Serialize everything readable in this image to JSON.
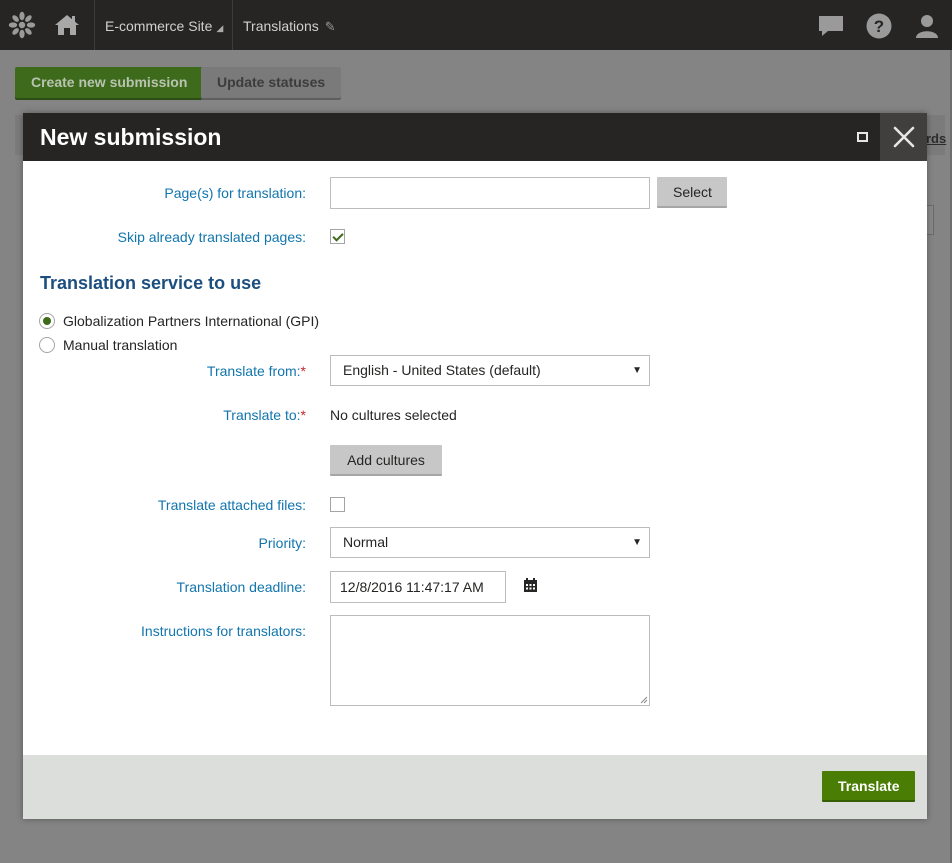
{
  "topbar": {
    "site_name": "E-commerce Site",
    "app_name": "Translations"
  },
  "background": {
    "create_button": "Create new submission",
    "update_button": "Update statuses",
    "partial_link": "rds"
  },
  "dialog": {
    "title": "New submission",
    "fields": {
      "pages_label": "Page(s) for translation:",
      "pages_value": "",
      "select_button": "Select",
      "skip_label": "Skip already translated pages:",
      "skip_checked": true
    },
    "service_section": {
      "title": "Translation service to use",
      "options": [
        {
          "label": "Globalization Partners International (GPI)",
          "selected": true
        },
        {
          "label": "Manual translation",
          "selected": false
        }
      ]
    },
    "translate_from": {
      "label": "Translate from:",
      "required_mark": "*",
      "value": "English - United States (default)"
    },
    "translate_to": {
      "label": "Translate to:",
      "required_mark": "*",
      "value": "No cultures selected",
      "add_button": "Add cultures"
    },
    "attached_files": {
      "label": "Translate attached files:",
      "checked": false
    },
    "priority": {
      "label": "Priority:",
      "value": "Normal"
    },
    "deadline": {
      "label": "Translation deadline:",
      "value": "12/8/2016 11:47:17 AM"
    },
    "instructions": {
      "label": "Instructions for translators:",
      "value": ""
    },
    "footer": {
      "translate_button": "Translate"
    }
  },
  "colors": {
    "header_dark": "#262524",
    "label_blue": "#1175ae",
    "section_blue": "#1c4f80",
    "primary_green": "#497d04",
    "required_red": "#c4262e"
  }
}
